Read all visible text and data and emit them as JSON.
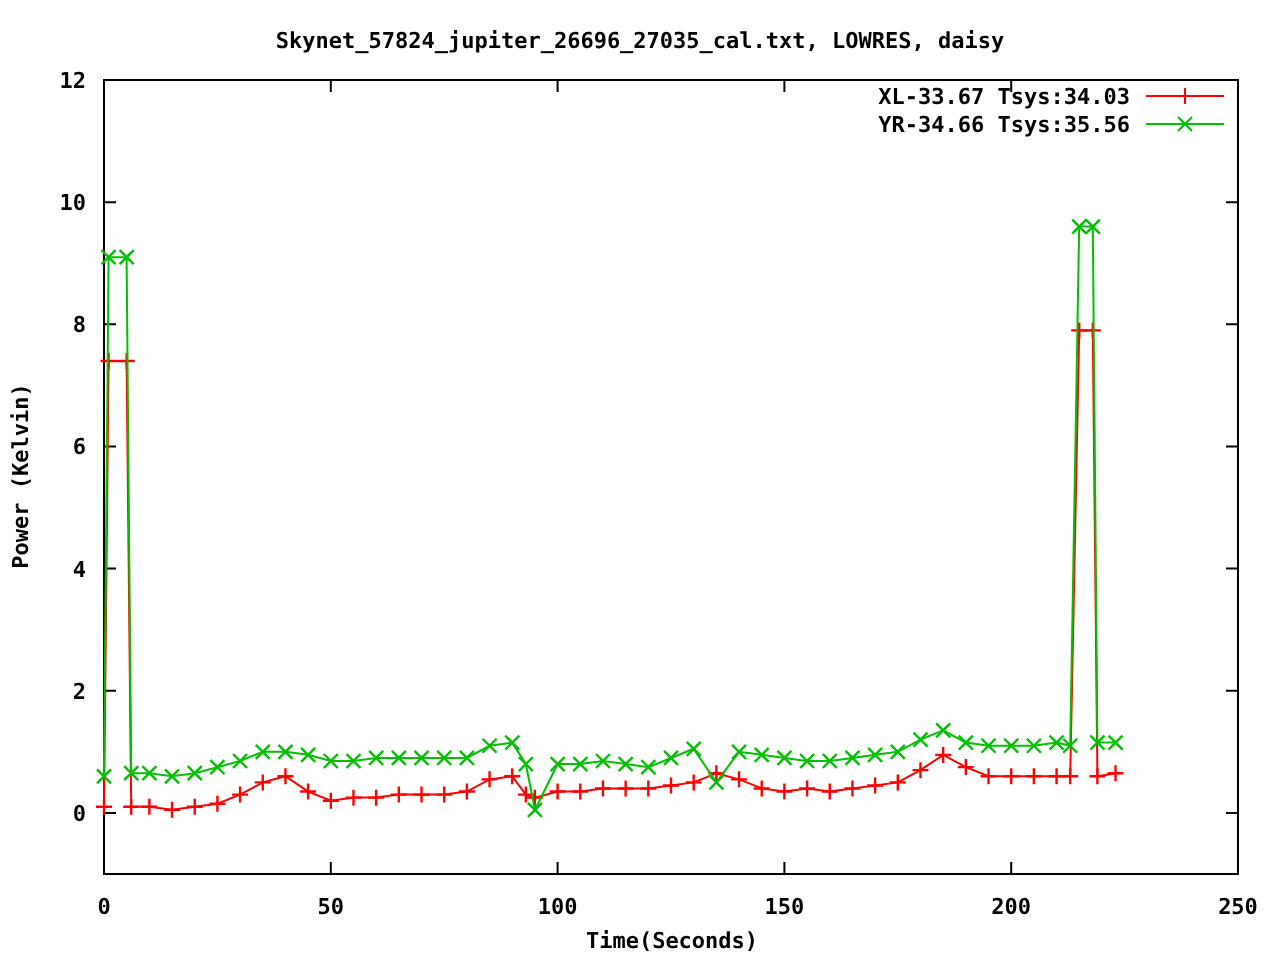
{
  "chart_data": {
    "type": "line",
    "legend": true,
    "title": "Skynet_57824_jupiter_26696_27035_cal.txt, LOWRES, daisy",
    "xlabel": "Time(Seconds)",
    "ylabel": "Power (Kelvin)",
    "xlim": [
      0,
      250
    ],
    "ylim": [
      -1,
      12
    ],
    "xticks": [
      0,
      50,
      100,
      150,
      200,
      250
    ],
    "yticks": [
      0,
      2,
      4,
      6,
      8,
      10,
      12
    ],
    "x": [
      0,
      1,
      5,
      6,
      10,
      15,
      20,
      25,
      30,
      35,
      40,
      45,
      50,
      55,
      60,
      65,
      70,
      75,
      80,
      85,
      90,
      93,
      95,
      100,
      105,
      110,
      115,
      120,
      125,
      130,
      135,
      140,
      145,
      150,
      155,
      160,
      165,
      170,
      175,
      180,
      185,
      190,
      195,
      200,
      205,
      210,
      213,
      215,
      218,
      219,
      223
    ],
    "series": [
      {
        "name": "XL-33.67 Tsys:34.03",
        "color": "#ff0000",
        "marker": "plus",
        "values": [
          0.1,
          7.4,
          7.4,
          0.1,
          0.1,
          0.05,
          0.1,
          0.15,
          0.3,
          0.5,
          0.6,
          0.35,
          0.2,
          0.25,
          0.25,
          0.3,
          0.3,
          0.3,
          0.35,
          0.55,
          0.6,
          0.3,
          0.25,
          0.35,
          0.35,
          0.4,
          0.4,
          0.4,
          0.45,
          0.5,
          0.65,
          0.55,
          0.4,
          0.35,
          0.4,
          0.35,
          0.4,
          0.45,
          0.5,
          0.7,
          0.95,
          0.75,
          0.6,
          0.6,
          0.6,
          0.6,
          0.6,
          7.9,
          7.9,
          0.6,
          0.65
        ]
      },
      {
        "name": "YR-34.66 Tsys:35.56",
        "color": "#00c000",
        "marker": "cross",
        "values": [
          0.6,
          9.1,
          9.1,
          0.65,
          0.65,
          0.6,
          0.65,
          0.75,
          0.85,
          1.0,
          1.0,
          0.95,
          0.85,
          0.85,
          0.9,
          0.9,
          0.9,
          0.9,
          0.9,
          1.1,
          1.15,
          0.8,
          0.05,
          0.8,
          0.8,
          0.85,
          0.8,
          0.75,
          0.9,
          1.05,
          0.5,
          1.0,
          0.95,
          0.9,
          0.85,
          0.85,
          0.9,
          0.95,
          1.0,
          1.2,
          1.35,
          1.15,
          1.1,
          1.1,
          1.1,
          1.15,
          1.1,
          9.6,
          9.6,
          1.15,
          1.15
        ]
      }
    ]
  }
}
